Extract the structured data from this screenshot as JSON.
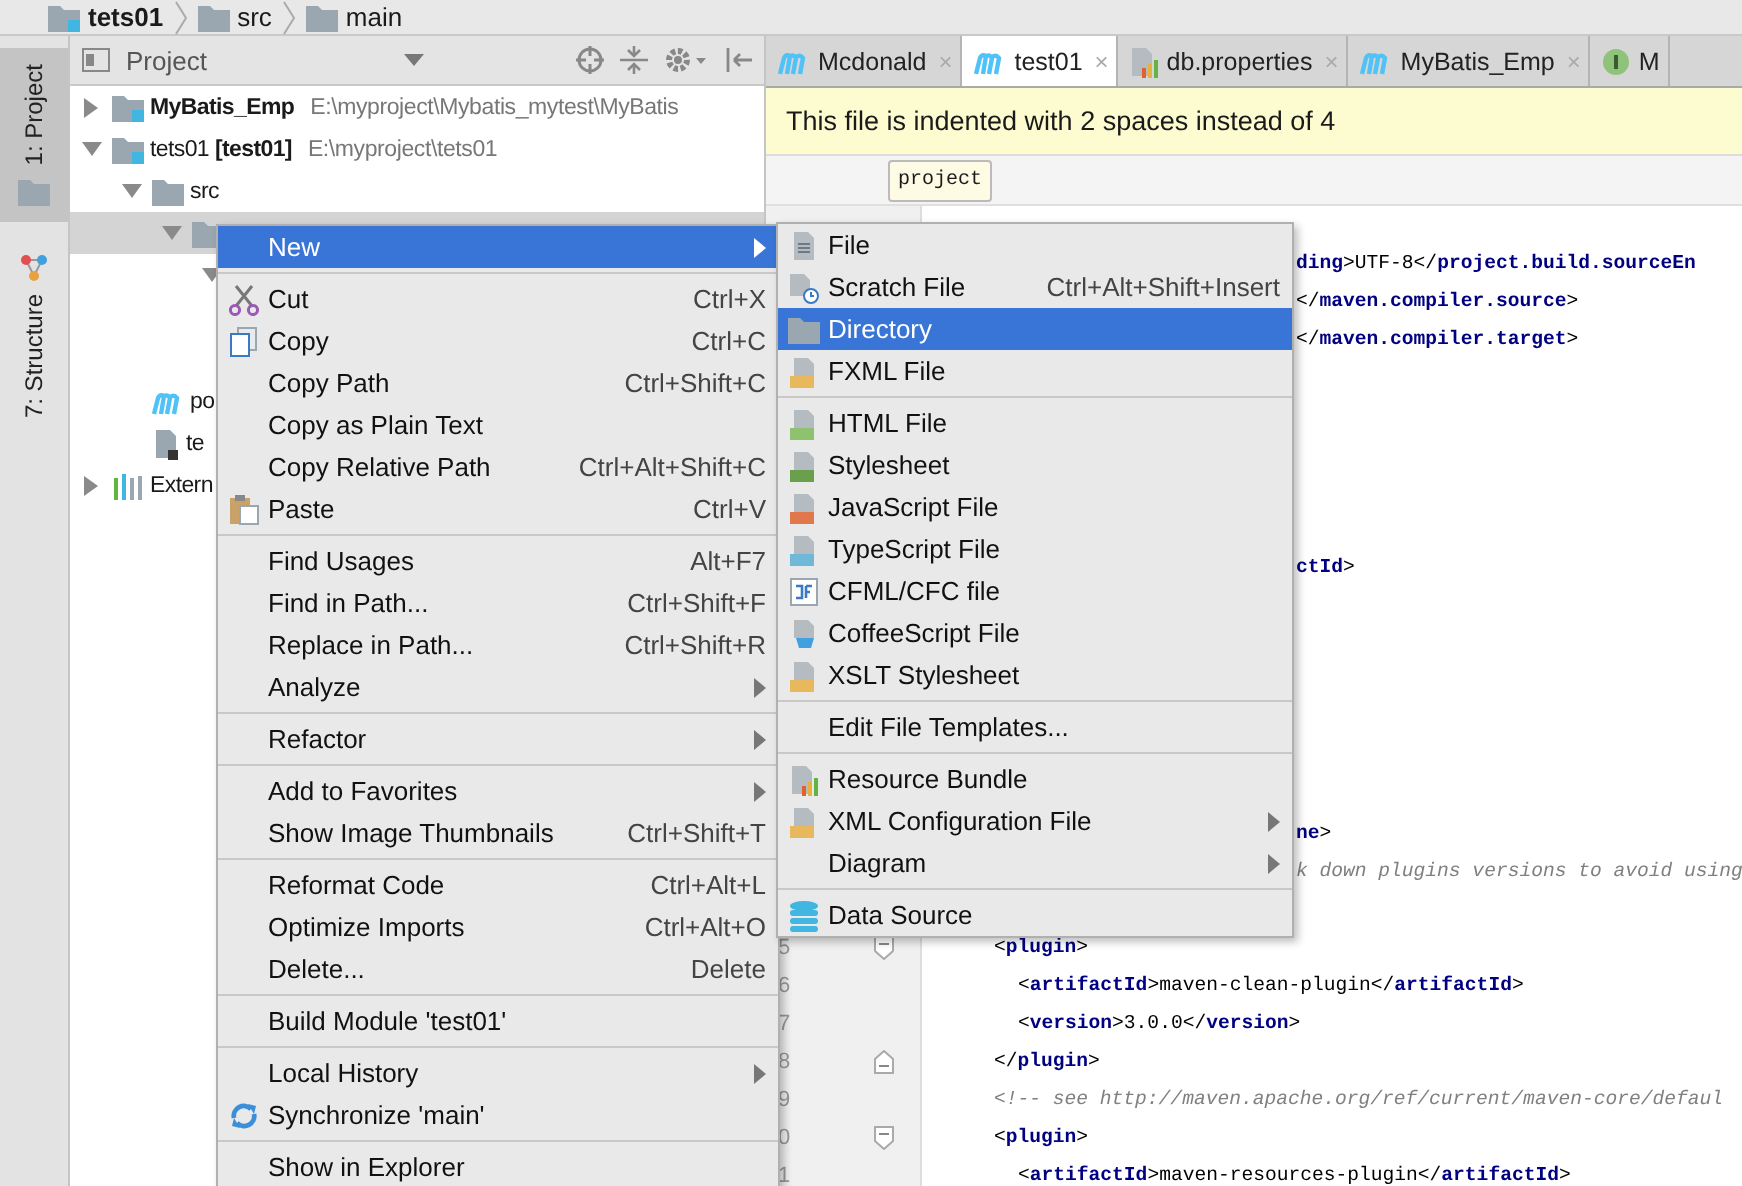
{
  "breadcrumbs": [
    {
      "label": "tets01",
      "kind": "module"
    },
    {
      "label": "src",
      "kind": "folder"
    },
    {
      "label": "main",
      "kind": "folder"
    }
  ],
  "tool_strip": [
    {
      "label": "1: Project",
      "kind": "project",
      "selected": true
    },
    {
      "label": "7: Structure",
      "kind": "structure",
      "selected": false
    }
  ],
  "project_panel": {
    "title": "Project",
    "tree": [
      {
        "label": "MyBatis_Emp",
        "path": "E:\\myproject\\Mybatis_mytest\\MyBatis",
        "kind": "module",
        "emphasized": true,
        "expanded": false,
        "selected": false
      },
      {
        "label": "tets01 **[test01]**",
        "path": "E:\\myproject\\tets01",
        "kind": "module",
        "emphasized": false,
        "expanded": true,
        "selected": false,
        "children": [
          {
            "label": "src",
            "kind": "folder",
            "emphasized": false,
            "expanded": true,
            "selected": false,
            "children": [
              {
                "kind": "folder",
                "expanded": true,
                "selected": true,
                "children": [
                  {
                    "expanded": true,
                    "selected": false
                  }
                ]
              }
            ]
          },
          {
            "label": "po",
            "kind": "maven",
            "emphasized": false,
            "selected": false
          },
          {
            "label": "te",
            "kind": "iml",
            "emphasized": false,
            "selected": false
          }
        ]
      },
      {
        "label": "Extern",
        "kind": "libraries",
        "emphasized": false,
        "expanded": false,
        "selected": false
      }
    ]
  },
  "editor": {
    "tabs": [
      {
        "label": "Mcdonald",
        "kind": "maven",
        "close": "×",
        "selected": false
      },
      {
        "label": "test01",
        "kind": "maven",
        "close": "×",
        "selected": true
      },
      {
        "label": "db.properties",
        "kind": "properties",
        "close": "×",
        "selected": false
      },
      {
        "label": "MyBatis_Emp",
        "kind": "maven",
        "close": "×",
        "selected": false
      },
      {
        "label": "M",
        "kind": "interface",
        "selected": false
      }
    ],
    "banner": "This file is indented with 2 spaces instead of 4",
    "breadcrumb_tag": "project",
    "lines": [
      {
        "kind": "blank"
      },
      {
        "kind": "fragment",
        "text": "**ding**>UTF-8</**project.build.sourceEn**"
      },
      {
        "kind": "fragment",
        "text": "</**maven.compiler.source**>"
      },
      {
        "kind": "fragment",
        "text": "</**maven.compiler.target**>"
      },
      {
        "kind": "blank"
      },
      {
        "kind": "blank"
      },
      {
        "kind": "blank"
      },
      {
        "kind": "blank"
      },
      {
        "kind": "blank"
      },
      {
        "kind": "fragment",
        "text": "**ctId**>"
      },
      {
        "kind": "blank"
      },
      {
        "kind": "blank"
      },
      {
        "kind": "blank"
      },
      {
        "kind": "blank"
      },
      {
        "kind": "blank"
      },
      {
        "kind": "blank"
      },
      {
        "kind": "fragment",
        "text": "**ne**>"
      },
      {
        "kind": "fragment-comment",
        "text": "k down plugins versions to avoid using"
      },
      {
        "kind": "blank"
      },
      {
        "kind": "level3",
        "number": "5",
        "fold_start": true,
        "fold_end": false,
        "text": "<**plugin**>"
      },
      {
        "kind": "level4",
        "number": "6",
        "fold_start": false,
        "fold_end": false,
        "text": "<**artifactId**>maven-clean-plugin</**artifactId**>"
      },
      {
        "kind": "level4",
        "number": "7",
        "fold_start": false,
        "fold_end": false,
        "text": "<**version**>3.0.0</**version**>"
      },
      {
        "kind": "level3",
        "number": "8",
        "fold_start": false,
        "fold_end": true,
        "text": "</**plugin**>"
      },
      {
        "kind": "comment3",
        "number": "9",
        "fold_start": false,
        "fold_end": false,
        "text": "<!-- see http://maven.apache.org/ref/current/maven-core/defaul"
      },
      {
        "kind": "level3",
        "number": "0",
        "fold_start": true,
        "fold_end": false,
        "text": "<**plugin**>"
      },
      {
        "kind": "level4",
        "number": "1",
        "fold_start": false,
        "fold_end": false,
        "text": "<**artifactId**>maven-resources-plugin</**artifactId**>"
      }
    ]
  },
  "context_menu": {
    "groups": [
      [
        {
          "label": "New",
          "submenu": true,
          "selected": true
        }
      ],
      [
        {
          "label": "Cut",
          "shortcut": "Ctrl+X",
          "kind": "cut",
          "submenu": false,
          "selected": false
        },
        {
          "label": "Copy",
          "shortcut": "Ctrl+C",
          "kind": "copy",
          "submenu": false,
          "selected": false
        },
        {
          "label": "Copy Path",
          "shortcut": "Ctrl+Shift+C",
          "submenu": false,
          "selected": false
        },
        {
          "label": "Copy as Plain Text",
          "submenu": false,
          "selected": false
        },
        {
          "label": "Copy Relative Path",
          "shortcut": "Ctrl+Alt+Shift+C",
          "submenu": false,
          "selected": false
        },
        {
          "label": "Paste",
          "shortcut": "Ctrl+V",
          "kind": "paste",
          "submenu": false,
          "selected": false
        }
      ],
      [
        {
          "label": "Find Usages",
          "shortcut": "Alt+F7",
          "submenu": false,
          "selected": false
        },
        {
          "label": "Find in Path...",
          "shortcut": "Ctrl+Shift+F",
          "submenu": false,
          "selected": false
        },
        {
          "label": "Replace in Path...",
          "shortcut": "Ctrl+Shift+R",
          "submenu": false,
          "selected": false
        },
        {
          "label": "Analyze",
          "submenu": true,
          "selected": false
        }
      ],
      [
        {
          "label": "Refactor",
          "submenu": true,
          "selected": false
        }
      ],
      [
        {
          "label": "Add to Favorites",
          "submenu": true,
          "selected": false
        },
        {
          "label": "Show Image Thumbnails",
          "shortcut": "Ctrl+Shift+T",
          "submenu": false,
          "selected": false
        }
      ],
      [
        {
          "label": "Reformat Code",
          "shortcut": "Ctrl+Alt+L",
          "submenu": false,
          "selected": false
        },
        {
          "label": "Optimize Imports",
          "shortcut": "Ctrl+Alt+O",
          "submenu": false,
          "selected": false
        },
        {
          "label": "Delete...",
          "shortcut": "Delete",
          "submenu": false,
          "selected": false
        }
      ],
      [
        {
          "label": "Build Module 'test01'",
          "submenu": false,
          "selected": false
        }
      ],
      [
        {
          "label": "Local History",
          "submenu": true,
          "selected": false
        },
        {
          "label": "Synchronize 'main'",
          "kind": "sync",
          "submenu": false,
          "selected": false
        }
      ],
      [
        {
          "label": "Show in Explorer",
          "submenu": false,
          "selected": false
        }
      ]
    ]
  },
  "submenu": {
    "groups": [
      [
        {
          "label": "File",
          "kind": "file",
          "submenu": false,
          "selected": false
        },
        {
          "label": "Scratch File",
          "shortcut": "Ctrl+Alt+Shift+Insert",
          "kind": "scratch",
          "submenu": false,
          "selected": false
        },
        {
          "label": "Directory",
          "kind": "folder",
          "submenu": false,
          "selected": true
        },
        {
          "label": "FXML File",
          "kind": "fxml",
          "submenu": false,
          "selected": false
        }
      ],
      [
        {
          "label": "HTML File",
          "kind": "html",
          "submenu": false,
          "selected": false
        },
        {
          "label": "Stylesheet",
          "kind": "css",
          "submenu": false,
          "selected": false
        },
        {
          "label": "JavaScript File",
          "kind": "js",
          "submenu": false,
          "selected": false
        },
        {
          "label": "TypeScript File",
          "kind": "ts",
          "submenu": false,
          "selected": false
        },
        {
          "label": "CFML/CFC file",
          "kind": "cfml",
          "submenu": false,
          "selected": false
        },
        {
          "label": "CoffeeScript File",
          "kind": "coffee",
          "submenu": false,
          "selected": false
        },
        {
          "label": "XSLT Stylesheet",
          "kind": "xml",
          "submenu": false,
          "selected": false
        }
      ],
      [
        {
          "label": "Edit File Templates...",
          "submenu": false,
          "selected": false
        }
      ],
      [
        {
          "label": "Resource Bundle",
          "kind": "bundle",
          "submenu": false,
          "selected": false
        },
        {
          "label": "XML Configuration File",
          "kind": "xml",
          "submenu": true,
          "selected": false
        },
        {
          "label": "Diagram",
          "submenu": true,
          "selected": false
        }
      ],
      [
        {
          "label": "Data Source",
          "kind": "database",
          "submenu": false,
          "selected": false
        }
      ]
    ]
  }
}
